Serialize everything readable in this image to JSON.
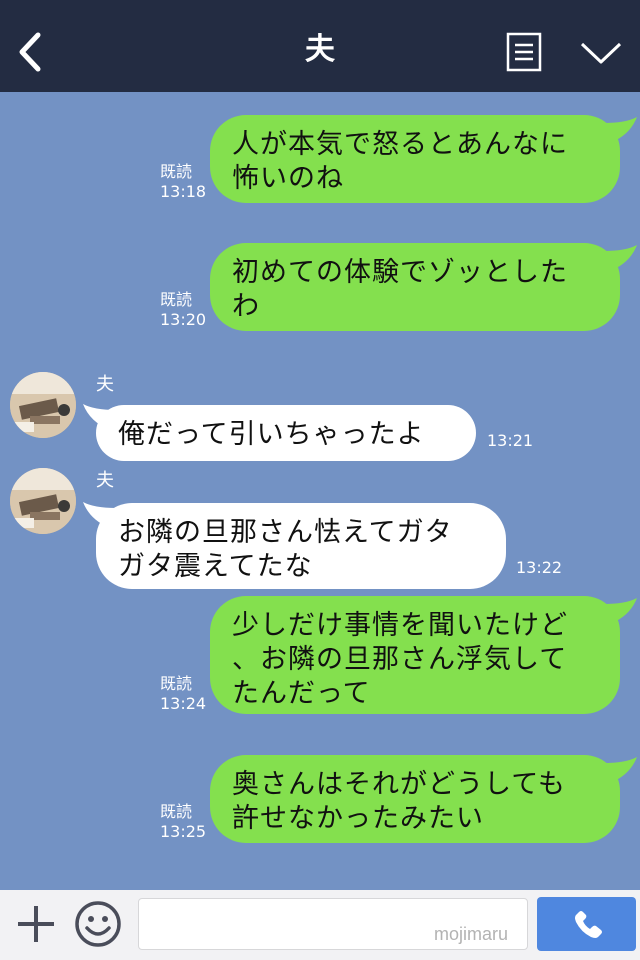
{
  "header": {
    "title": "夫"
  },
  "messages": [
    {
      "side": "right",
      "text": "人が本気で怒るとあんなに\n怖いのね",
      "read": "既読",
      "time": "13:18"
    },
    {
      "side": "right",
      "text": "初めての体験でゾッとした\nわ",
      "read": "既読",
      "time": "13:20"
    },
    {
      "side": "left",
      "sender": "夫",
      "text": "俺だって引いちゃったよ",
      "time": "13:21"
    },
    {
      "side": "left",
      "sender": "夫",
      "text": "お隣の旦那さん怯えてガタ\nガタ震えてたな",
      "time": "13:22"
    },
    {
      "side": "right",
      "text": "少しだけ事情を聞いたけど\n、お隣の旦那さん浮気して\nたんだって",
      "read": "既読",
      "time": "13:24"
    },
    {
      "side": "right",
      "text": "奥さんはそれがどうしても\n許せなかったみたい",
      "read": "既読",
      "time": "13:25"
    }
  ],
  "footer": {
    "input_placeholder": "",
    "watermark": "mojimaru"
  },
  "colors": {
    "header_bg": "#232c42",
    "chat_bg": "#7392c4",
    "bubble_green": "#84e04e",
    "bubble_white": "#ffffff",
    "call_button": "#4f87df"
  },
  "icons": {
    "back": "chevron-left-icon",
    "notes": "notes-icon",
    "menu": "chevron-down-icon",
    "plus": "plus-icon",
    "emoji": "smiley-icon",
    "call": "phone-icon"
  }
}
